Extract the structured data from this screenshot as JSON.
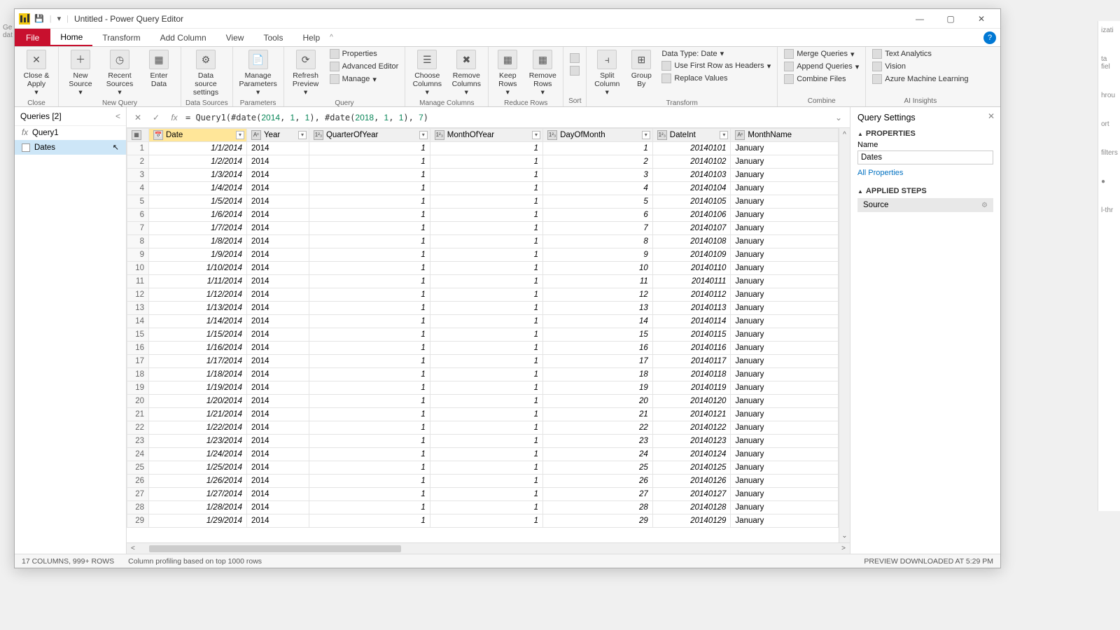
{
  "window": {
    "title": "Untitled - Power Query Editor"
  },
  "tabs": {
    "file": "File",
    "home": "Home",
    "transform": "Transform",
    "addColumn": "Add Column",
    "view": "View",
    "tools": "Tools",
    "help": "Help"
  },
  "ribbon": {
    "closeApply": "Close & Apply",
    "newSource": "New Source",
    "recentSources": "Recent Sources",
    "enterData": "Enter Data",
    "dataSourceSettings": "Data source settings",
    "manageParameters": "Manage Parameters",
    "refreshPreview": "Refresh Preview",
    "properties": "Properties",
    "advancedEditor": "Advanced Editor",
    "manage": "Manage",
    "chooseColumns": "Choose Columns",
    "removeColumns": "Remove Columns",
    "keepRows": "Keep Rows",
    "removeRows": "Remove Rows",
    "splitColumn": "Split Column",
    "groupBy": "Group By",
    "dataType": "Data Type: Date",
    "useFirstRow": "Use First Row as Headers",
    "replaceValues": "Replace Values",
    "mergeQueries": "Merge Queries",
    "appendQueries": "Append Queries",
    "combineFiles": "Combine Files",
    "textAnalytics": "Text Analytics",
    "vision": "Vision",
    "azureML": "Azure Machine Learning",
    "groups": {
      "close": "Close",
      "newQuery": "New Query",
      "dataSources": "Data Sources",
      "parameters": "Parameters",
      "query": "Query",
      "manageColumns": "Manage Columns",
      "reduceRows": "Reduce Rows",
      "sort": "Sort",
      "transform": "Transform",
      "combine": "Combine",
      "aiInsights": "AI Insights"
    }
  },
  "queries": {
    "header": "Queries [2]",
    "items": [
      {
        "name": "Query1"
      },
      {
        "name": "Dates"
      }
    ]
  },
  "formula": "= Query1(#date(2014, 1, 1), #date(2018, 1, 1), 7)",
  "columns": [
    {
      "name": "Date",
      "type": "date"
    },
    {
      "name": "Year",
      "type": "text"
    },
    {
      "name": "QuarterOfYear",
      "type": "number"
    },
    {
      "name": "MonthOfYear",
      "type": "number"
    },
    {
      "name": "DayOfMonth",
      "type": "number"
    },
    {
      "name": "DateInt",
      "type": "number"
    },
    {
      "name": "MonthName",
      "type": "text"
    }
  ],
  "rows": [
    {
      "n": 1,
      "date": "1/1/2014",
      "year": "2014",
      "q": 1,
      "m": 1,
      "d": 1,
      "di": 20140101,
      "mn": "January"
    },
    {
      "n": 2,
      "date": "1/2/2014",
      "year": "2014",
      "q": 1,
      "m": 1,
      "d": 2,
      "di": 20140102,
      "mn": "January"
    },
    {
      "n": 3,
      "date": "1/3/2014",
      "year": "2014",
      "q": 1,
      "m": 1,
      "d": 3,
      "di": 20140103,
      "mn": "January"
    },
    {
      "n": 4,
      "date": "1/4/2014",
      "year": "2014",
      "q": 1,
      "m": 1,
      "d": 4,
      "di": 20140104,
      "mn": "January"
    },
    {
      "n": 5,
      "date": "1/5/2014",
      "year": "2014",
      "q": 1,
      "m": 1,
      "d": 5,
      "di": 20140105,
      "mn": "January"
    },
    {
      "n": 6,
      "date": "1/6/2014",
      "year": "2014",
      "q": 1,
      "m": 1,
      "d": 6,
      "di": 20140106,
      "mn": "January"
    },
    {
      "n": 7,
      "date": "1/7/2014",
      "year": "2014",
      "q": 1,
      "m": 1,
      "d": 7,
      "di": 20140107,
      "mn": "January"
    },
    {
      "n": 8,
      "date": "1/8/2014",
      "year": "2014",
      "q": 1,
      "m": 1,
      "d": 8,
      "di": 20140108,
      "mn": "January"
    },
    {
      "n": 9,
      "date": "1/9/2014",
      "year": "2014",
      "q": 1,
      "m": 1,
      "d": 9,
      "di": 20140109,
      "mn": "January"
    },
    {
      "n": 10,
      "date": "1/10/2014",
      "year": "2014",
      "q": 1,
      "m": 1,
      "d": 10,
      "di": 20140110,
      "mn": "January"
    },
    {
      "n": 11,
      "date": "1/11/2014",
      "year": "2014",
      "q": 1,
      "m": 1,
      "d": 11,
      "di": 20140111,
      "mn": "January"
    },
    {
      "n": 12,
      "date": "1/12/2014",
      "year": "2014",
      "q": 1,
      "m": 1,
      "d": 12,
      "di": 20140112,
      "mn": "January"
    },
    {
      "n": 13,
      "date": "1/13/2014",
      "year": "2014",
      "q": 1,
      "m": 1,
      "d": 13,
      "di": 20140113,
      "mn": "January"
    },
    {
      "n": 14,
      "date": "1/14/2014",
      "year": "2014",
      "q": 1,
      "m": 1,
      "d": 14,
      "di": 20140114,
      "mn": "January"
    },
    {
      "n": 15,
      "date": "1/15/2014",
      "year": "2014",
      "q": 1,
      "m": 1,
      "d": 15,
      "di": 20140115,
      "mn": "January"
    },
    {
      "n": 16,
      "date": "1/16/2014",
      "year": "2014",
      "q": 1,
      "m": 1,
      "d": 16,
      "di": 20140116,
      "mn": "January"
    },
    {
      "n": 17,
      "date": "1/17/2014",
      "year": "2014",
      "q": 1,
      "m": 1,
      "d": 17,
      "di": 20140117,
      "mn": "January"
    },
    {
      "n": 18,
      "date": "1/18/2014",
      "year": "2014",
      "q": 1,
      "m": 1,
      "d": 18,
      "di": 20140118,
      "mn": "January"
    },
    {
      "n": 19,
      "date": "1/19/2014",
      "year": "2014",
      "q": 1,
      "m": 1,
      "d": 19,
      "di": 20140119,
      "mn": "January"
    },
    {
      "n": 20,
      "date": "1/20/2014",
      "year": "2014",
      "q": 1,
      "m": 1,
      "d": 20,
      "di": 20140120,
      "mn": "January"
    },
    {
      "n": 21,
      "date": "1/21/2014",
      "year": "2014",
      "q": 1,
      "m": 1,
      "d": 21,
      "di": 20140121,
      "mn": "January"
    },
    {
      "n": 22,
      "date": "1/22/2014",
      "year": "2014",
      "q": 1,
      "m": 1,
      "d": 22,
      "di": 20140122,
      "mn": "January"
    },
    {
      "n": 23,
      "date": "1/23/2014",
      "year": "2014",
      "q": 1,
      "m": 1,
      "d": 23,
      "di": 20140123,
      "mn": "January"
    },
    {
      "n": 24,
      "date": "1/24/2014",
      "year": "2014",
      "q": 1,
      "m": 1,
      "d": 24,
      "di": 20140124,
      "mn": "January"
    },
    {
      "n": 25,
      "date": "1/25/2014",
      "year": "2014",
      "q": 1,
      "m": 1,
      "d": 25,
      "di": 20140125,
      "mn": "January"
    },
    {
      "n": 26,
      "date": "1/26/2014",
      "year": "2014",
      "q": 1,
      "m": 1,
      "d": 26,
      "di": 20140126,
      "mn": "January"
    },
    {
      "n": 27,
      "date": "1/27/2014",
      "year": "2014",
      "q": 1,
      "m": 1,
      "d": 27,
      "di": 20140127,
      "mn": "January"
    },
    {
      "n": 28,
      "date": "1/28/2014",
      "year": "2014",
      "q": 1,
      "m": 1,
      "d": 28,
      "di": 20140128,
      "mn": "January"
    },
    {
      "n": 29,
      "date": "1/29/2014",
      "year": "2014",
      "q": 1,
      "m": 1,
      "d": 29,
      "di": 20140129,
      "mn": "January"
    }
  ],
  "settings": {
    "title": "Query Settings",
    "properties": "PROPERTIES",
    "nameLabel": "Name",
    "nameValue": "Dates",
    "allProperties": "All Properties",
    "appliedSteps": "APPLIED STEPS",
    "steps": [
      "Source"
    ]
  },
  "status": {
    "left1": "17 COLUMNS, 999+ ROWS",
    "left2": "Column profiling based on top 1000 rows",
    "right": "PREVIEW DOWNLOADED AT 5:29 PM"
  }
}
